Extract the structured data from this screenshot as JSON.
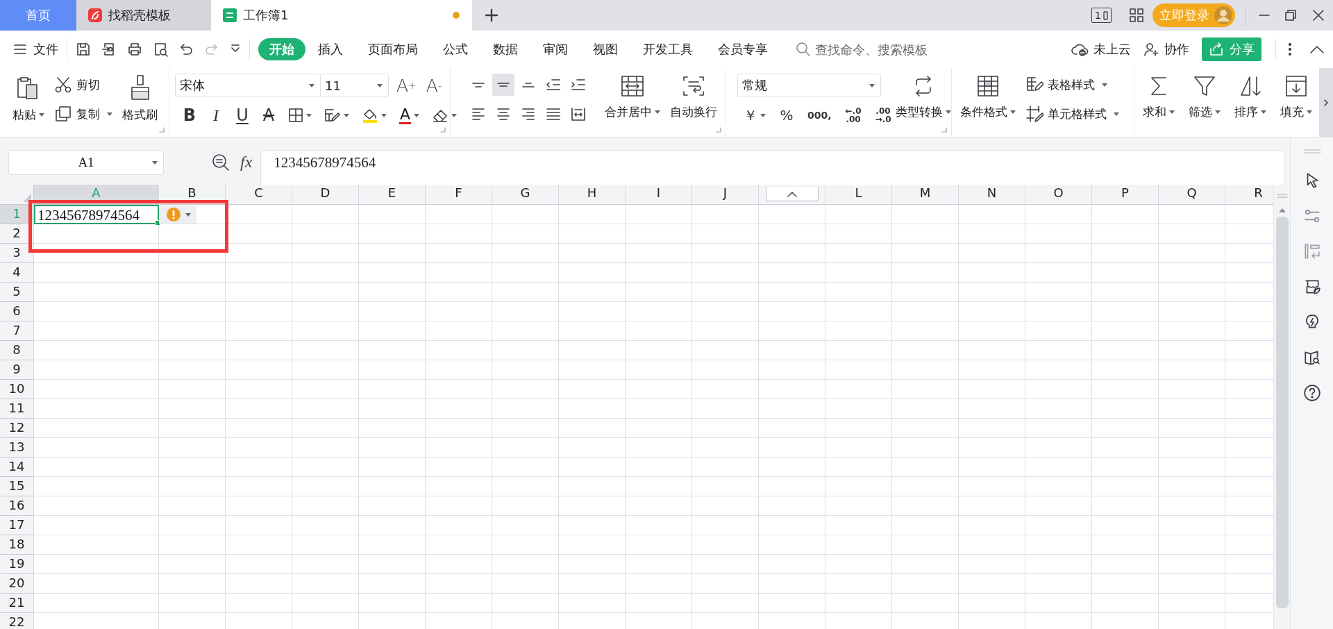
{
  "title_bar": {
    "tabs": [
      {
        "label": "首页",
        "kind": "home",
        "selected": false
      },
      {
        "label": "找稻壳模板",
        "kind": "docer",
        "selected": false
      },
      {
        "label": "工作簿1",
        "kind": "sheet",
        "selected": true,
        "unsaved": true
      }
    ],
    "view_count": "1",
    "login": "立即登录"
  },
  "menu_bar": {
    "file": "文件",
    "tabs": [
      {
        "label": "开始",
        "selected": true
      },
      {
        "label": "插入",
        "selected": false
      },
      {
        "label": "页面布局",
        "selected": false
      },
      {
        "label": "公式",
        "selected": false
      },
      {
        "label": "数据",
        "selected": false
      },
      {
        "label": "审阅",
        "selected": false
      },
      {
        "label": "视图",
        "selected": false
      },
      {
        "label": "开发工具",
        "selected": false
      },
      {
        "label": "会员专享",
        "selected": false
      }
    ],
    "search": {
      "placeholder": "查找命令、搜索模板"
    },
    "cloud": "未上云",
    "collaborate": "协作",
    "share": "分享"
  },
  "ribbon": {
    "clipboard": {
      "paste": "粘贴",
      "cut": "剪切",
      "copy": "复制",
      "format_painter": "格式刷"
    },
    "font": {
      "name": "宋体",
      "size": "11",
      "size_buttons": [
        {
          "label": "A$^{+}$"
        },
        {
          "label": "A$^{-}$"
        }
      ],
      "style_buttons": [
        {
          "kind": "bold",
          "label": "B"
        },
        {
          "kind": "italic",
          "label": "I"
        },
        {
          "kind": "underline",
          "label": "U"
        },
        {
          "kind": "strike",
          "label": "A"
        },
        {
          "kind": "borders"
        },
        {
          "kind": "cell-type"
        },
        {
          "kind": "fill-color"
        },
        {
          "kind": "font-color",
          "label": "A"
        },
        {
          "kind": "eraser"
        }
      ]
    },
    "alignment": {
      "vertical": [
        {
          "selected": false
        },
        {
          "selected": true
        },
        {
          "selected": false
        }
      ],
      "merge": "合并居中",
      "wrap": "自动换行"
    },
    "number": {
      "format": "常规",
      "buttons": [
        {
          "kind": "currency",
          "label": "￥"
        },
        {
          "kind": "percent",
          "label": "%"
        },
        {
          "kind": "thousands",
          "label": "000,"
        },
        {
          "kind": "add-decimal",
          "top": "←.0",
          "bottom": ".00"
        },
        {
          "kind": "remove-decimal",
          "top": ".00",
          "bottom": "→.0"
        }
      ],
      "convert": "类型转换"
    },
    "styles": {
      "conditional": "条件格式",
      "table_style": "表格样式",
      "cell_style": "单元格样式"
    },
    "editing": [
      {
        "kind": "sum",
        "label": "求和"
      },
      {
        "kind": "filter",
        "label": "筛选"
      },
      {
        "kind": "sort",
        "label": "排序"
      },
      {
        "kind": "fill",
        "label": "填充"
      }
    ]
  },
  "formula_bar": {
    "name_box": "A1",
    "function_label": "fx",
    "formula": "12345678974564"
  },
  "sheet": {
    "columns": [
      {
        "label": "A",
        "selected": true
      },
      {
        "label": "B",
        "selected": false
      },
      {
        "label": "C",
        "selected": false
      },
      {
        "label": "D",
        "selected": false
      },
      {
        "label": "E",
        "selected": false
      },
      {
        "label": "F",
        "selected": false
      },
      {
        "label": "G",
        "selected": false
      },
      {
        "label": "H",
        "selected": false
      },
      {
        "label": "I",
        "selected": false
      },
      {
        "label": "J",
        "selected": false
      },
      {
        "kind": "covered"
      },
      {
        "label": "L",
        "selected": false
      },
      {
        "label": "M",
        "selected": false
      },
      {
        "label": "N",
        "selected": false
      },
      {
        "label": "O",
        "selected": false
      },
      {
        "label": "P",
        "selected": false
      },
      {
        "label": "Q",
        "selected": false
      },
      {
        "label": "R",
        "selected": false
      }
    ],
    "rows": [
      {
        "label": "1",
        "selected": true
      },
      {
        "label": "2",
        "selected": false
      },
      {
        "label": "3",
        "selected": false
      },
      {
        "label": "4",
        "selected": false
      },
      {
        "label": "5",
        "selected": false
      },
      {
        "label": "6",
        "selected": false
      },
      {
        "label": "7",
        "selected": false
      },
      {
        "label": "8",
        "selected": false
      },
      {
        "label": "9",
        "selected": false
      },
      {
        "label": "10",
        "selected": false
      },
      {
        "label": "11",
        "selected": false
      },
      {
        "label": "12",
        "selected": false
      },
      {
        "label": "13",
        "selected": false
      },
      {
        "label": "14",
        "selected": false
      },
      {
        "label": "15",
        "selected": false
      },
      {
        "label": "16",
        "selected": false
      },
      {
        "label": "17",
        "selected": false
      },
      {
        "label": "18",
        "selected": false
      },
      {
        "label": "19",
        "selected": false
      },
      {
        "label": "20",
        "selected": false
      },
      {
        "label": "21",
        "selected": false
      },
      {
        "label": "22",
        "selected": false
      }
    ],
    "active_cell": {
      "value": "12345678974564",
      "error_check": true
    }
  }
}
